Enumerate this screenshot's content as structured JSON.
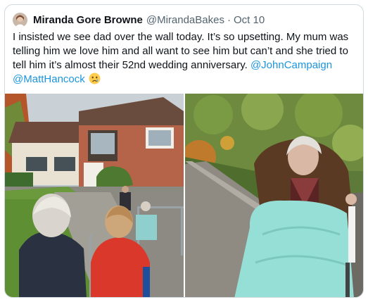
{
  "tweet": {
    "author_name": "Miranda Gore Browne",
    "author_handle": "@MirandaBakes",
    "separator": "·",
    "date": "Oct 10",
    "text_parts": [
      "I insisted we see dad over the wall today. It’s so upsetting. My mum was\ntelling him we love him and all want to see him but can’t and she tried to\ntell him it’s almost their 52nd wedding anniversary. ",
      "@JohnCampaign",
      "\n",
      "@MattHancock",
      " "
    ],
    "emoji": "crying-face-icon"
  },
  "colors": {
    "text": "#0f1419",
    "secondary": "#536471",
    "link": "#1b95e0",
    "border": "#cfd9de"
  },
  "media": {
    "photos": [
      "photo-over-the-wall",
      "photo-dad-in-wheelchair"
    ]
  }
}
